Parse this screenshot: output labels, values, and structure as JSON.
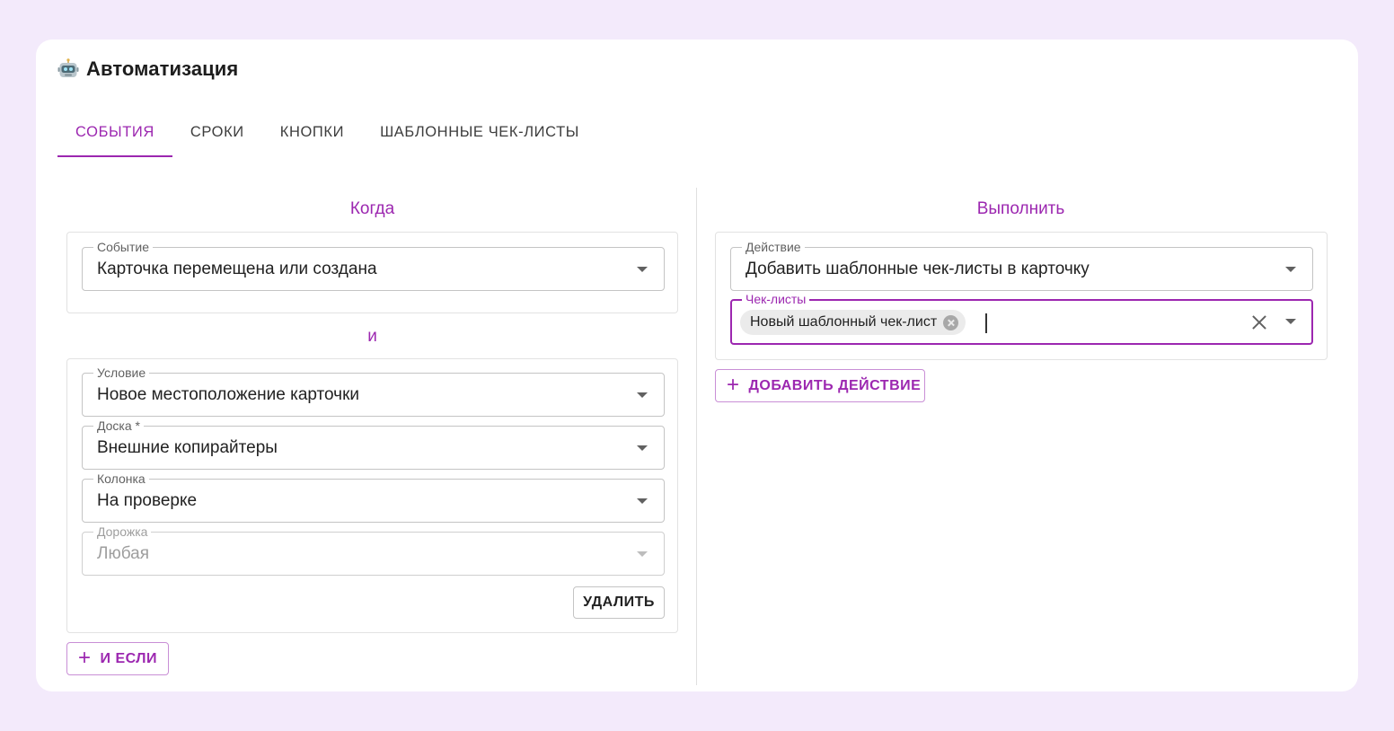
{
  "header": {
    "icon": "robot-icon",
    "title": "Автоматизация"
  },
  "tabs": [
    {
      "label": "СОБЫТИЯ",
      "active": true
    },
    {
      "label": "СРОКИ",
      "active": false
    },
    {
      "label": "КНОПКИ",
      "active": false
    },
    {
      "label": "ШАБЛОННЫЕ ЧЕК-ЛИСТЫ",
      "active": false
    }
  ],
  "when": {
    "title": "Когда",
    "event": {
      "label": "Событие",
      "value": "Карточка перемещена или создана"
    },
    "and_label": "и",
    "condition": {
      "fields": [
        {
          "label": "Условие",
          "value": "Новое местоположение карточки"
        },
        {
          "label": "Доска *",
          "value": "Внешние копирайтеры"
        },
        {
          "label": "Колонка",
          "value": "На проверке"
        },
        {
          "label": "Дорожка",
          "value": "Любая",
          "disabled": true
        }
      ],
      "delete_label": "УДАЛИТЬ"
    },
    "add_if_label": "И ЕСЛИ"
  },
  "execute": {
    "title": "Выполнить",
    "action": {
      "label": "Действие",
      "value": "Добавить шаблонные чек-листы в карточку"
    },
    "checklists": {
      "label": "Чек-листы",
      "chip": "Новый шаблонный чек-лист"
    },
    "add_action_label": "ДОБАВИТЬ ДЕЙСТВИЕ"
  },
  "colors": {
    "accent": "#9c27b0",
    "background": "#f3eafb",
    "card": "#ffffff"
  }
}
